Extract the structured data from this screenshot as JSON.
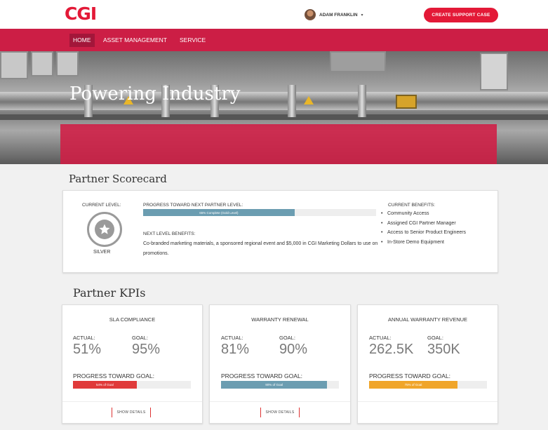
{
  "header": {
    "logo": "CGI",
    "user_name": "ADAM FRANKLIN",
    "caret": "▾",
    "support_button": "CREATE SUPPORT CASE"
  },
  "nav": {
    "items": [
      {
        "label": "HOME"
      },
      {
        "label": "ASSET MANAGEMENT"
      },
      {
        "label": "SERVICE"
      }
    ]
  },
  "hero": {
    "title": "Powering Industry"
  },
  "scorecard": {
    "section_title": "Partner Scorecard",
    "current_level_label": "CURRENT LEVEL:",
    "current_level": "SILVER",
    "progress_label": "PROGRESS TOWARD NEXT PARTNER LEVEL:",
    "progress_text": "65% Complete (Gold Level)",
    "progress_fraction": 0.65,
    "next_benefits_label": "NEXT LEVEL BENEFITS:",
    "next_benefits_text": "Co-branded marketing materials, a sponsored regional event and $5,000 in CGI Marketing Dollars to use on promotions.",
    "current_benefits_label": "CURRENT BENEFITS:",
    "current_benefits": [
      "Community Access",
      "Assigned CGI Partner Manager",
      "Access to Senior Product Engineers",
      "In-Store Demo Equipment"
    ]
  },
  "kpis": {
    "section_title": "Partner KPIs",
    "actual_label": "ACTUAL:",
    "goal_label": "GOAL:",
    "progress_label": "PROGRESS TOWARD GOAL:",
    "details_button": "SHOW DETAILS",
    "cards": [
      {
        "title": "SLA COMPLIANCE",
        "actual": "51%",
        "goal": "95%",
        "progress_text": "54% of Goal",
        "progress_fraction": 0.54,
        "color": "#e03a3a"
      },
      {
        "title": "WARRANTY RENEWAL",
        "actual": "81%",
        "goal": "90%",
        "progress_text": "90% of Goal",
        "progress_fraction": 0.9,
        "color": "#6b9db1"
      },
      {
        "title": "ANNUAL WARRANTY REVENUE",
        "actual": "262.5K",
        "goal": "350K",
        "progress_text": "75% of Goal",
        "progress_fraction": 0.75,
        "color": "#f0a52a"
      }
    ]
  },
  "colors": {
    "brand": "#e31937",
    "nav": "#cc1e45",
    "scorecard_bar": "#6b9db1"
  }
}
